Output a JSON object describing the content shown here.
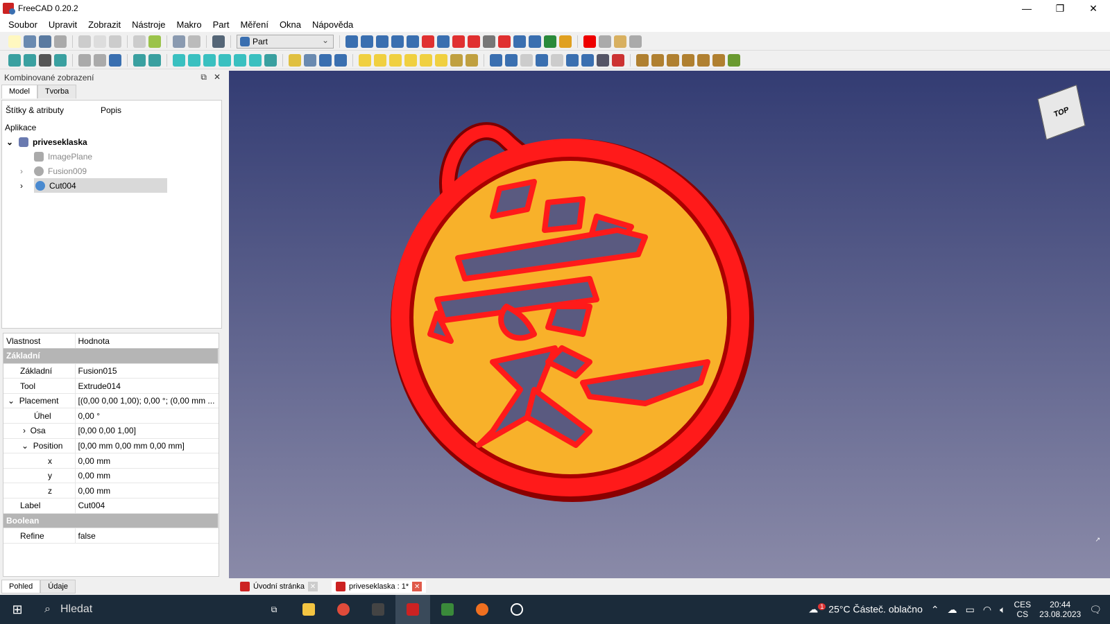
{
  "window": {
    "title": "FreeCAD 0.20.2",
    "minimize": "—",
    "restore": "❐",
    "close": "✕"
  },
  "menu": [
    "Soubor",
    "Upravit",
    "Zobrazit",
    "Nástroje",
    "Makro",
    "Part",
    "Měření",
    "Okna",
    "Nápověda"
  ],
  "toolbar": {
    "workbench": "Part"
  },
  "combo": {
    "title": "Kombinované zobrazení",
    "tabs": [
      "Model",
      "Tvorba"
    ],
    "tree_headers": [
      "Štítky & atributy",
      "Popis"
    ],
    "app_label": "Aplikace",
    "items": [
      {
        "label": "priveseklaska"
      },
      {
        "label": "ImagePlane"
      },
      {
        "label": "Fusion009"
      },
      {
        "label": "Cut004"
      }
    ]
  },
  "properties": {
    "headers": [
      "Vlastnost",
      "Hodnota"
    ],
    "rows": [
      {
        "name": "Základní",
        "value": ""
      },
      {
        "name": "Základní",
        "value": "Fusion015"
      },
      {
        "name": "Tool",
        "value": "Extrude014"
      },
      {
        "name": "Placement",
        "value": "[(0,00 0,00 1,00); 0,00 °; (0,00 mm ..."
      },
      {
        "name": "Úhel",
        "value": "0,00 °"
      },
      {
        "name": "Osa",
        "value": "[0,00 0,00 1,00]"
      },
      {
        "name": "Position",
        "value": "[0,00 mm  0,00 mm  0,00 mm]"
      },
      {
        "name": "x",
        "value": "0,00 mm"
      },
      {
        "name": "y",
        "value": "0,00 mm"
      },
      {
        "name": "z",
        "value": "0,00 mm"
      },
      {
        "name": "Label",
        "value": "Cut004"
      },
      {
        "name": "Boolean",
        "value": ""
      },
      {
        "name": "Refine",
        "value": "false"
      }
    ],
    "bottom_tabs": [
      "Pohled",
      "Údaje"
    ]
  },
  "navcube": {
    "face": "TOP"
  },
  "doc_tabs": [
    {
      "label": "Úvodní stránka"
    },
    {
      "label": "priveseklaska : 1*"
    }
  ],
  "taskbar": {
    "search": "Hledat",
    "weather": "25°C  Částeč. oblačno",
    "badge": "1",
    "lang1": "CES",
    "lang2": "CS",
    "time": "20:44",
    "date": "23.08.2023"
  },
  "colors": {
    "accent": "#e02020",
    "disc": "#f8b12a",
    "bg_top": "#333c73"
  }
}
